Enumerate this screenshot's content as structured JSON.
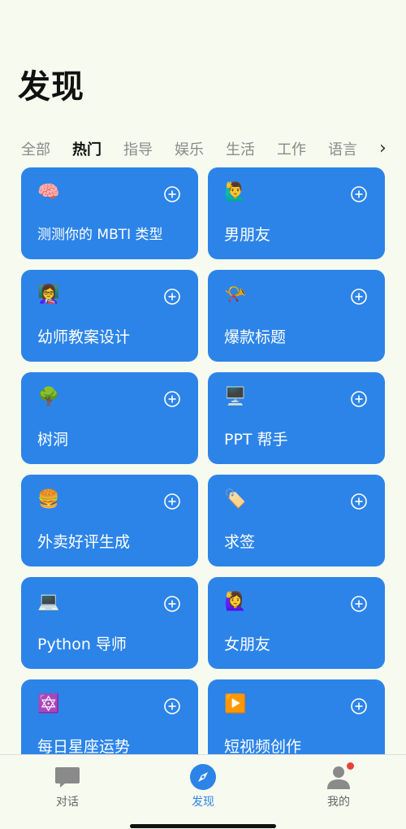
{
  "header": {
    "title": "发现"
  },
  "tabs": [
    {
      "label": "全部"
    },
    {
      "label": "热门",
      "active": true
    },
    {
      "label": "指导"
    },
    {
      "label": "娱乐"
    },
    {
      "label": "生活"
    },
    {
      "label": "工作"
    },
    {
      "label": "语言"
    }
  ],
  "tabs_more_glyph": "›",
  "cards": [
    {
      "emoji": "🧠",
      "label": "测测你的 MBTI 类型"
    },
    {
      "emoji": "🙋‍♂️",
      "label": "男朋友"
    },
    {
      "emoji": "👩‍🏫",
      "label": "幼师教案设计"
    },
    {
      "emoji": "📯",
      "label": "爆款标题"
    },
    {
      "emoji": "🌳",
      "label": "树洞"
    },
    {
      "emoji": "🖥️",
      "label": "PPT 帮手"
    },
    {
      "emoji": "🍔",
      "label": "外卖好评生成"
    },
    {
      "emoji": "🏷️",
      "label": "求签"
    },
    {
      "emoji": "💻",
      "label": "Python 导师"
    },
    {
      "emoji": "🙋‍♀️",
      "label": "女朋友"
    },
    {
      "emoji": "🔯",
      "label": "每日星座运势"
    },
    {
      "emoji": "▶️",
      "label": "短视频创作"
    }
  ],
  "card_add_icon": "plus-circle-icon",
  "bottom_nav": {
    "chat": {
      "label": "对话",
      "icon": "chat-bubble-icon"
    },
    "discover": {
      "label": "发现",
      "icon": "compass-icon",
      "active": true
    },
    "me": {
      "label": "我的",
      "icon": "person-icon",
      "badge": true
    }
  },
  "colors": {
    "background": "#f7fbef",
    "card": "#2c84e8",
    "accent": "#2c84e8",
    "badge": "#e8403a"
  }
}
